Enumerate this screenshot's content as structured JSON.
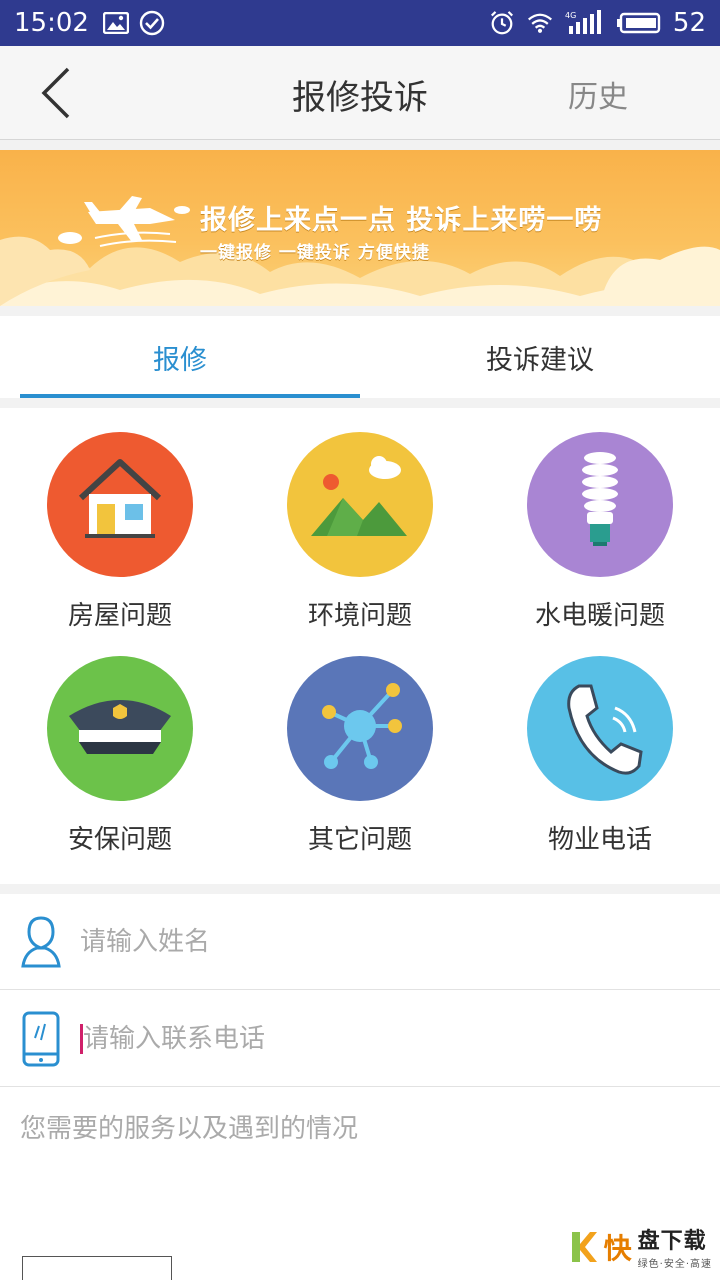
{
  "status_bar": {
    "time": "15:02",
    "battery": "52",
    "network": "4G"
  },
  "header": {
    "title": "报修投诉",
    "history": "历史"
  },
  "banner": {
    "line1": "报修上来点一点    投诉上来唠一唠",
    "line2": "一键报修   一键投诉  方便快捷"
  },
  "tabs": [
    {
      "label": "报修",
      "active": true
    },
    {
      "label": "投诉建议",
      "active": false
    }
  ],
  "categories": [
    {
      "label": "房屋问题",
      "icon": "house-icon",
      "color": "#ee5a30"
    },
    {
      "label": "环境问题",
      "icon": "landscape-icon",
      "color": "#f2c43d"
    },
    {
      "label": "水电暖问题",
      "icon": "bulb-icon",
      "color": "#a985d3"
    },
    {
      "label": "安保问题",
      "icon": "police-cap-icon",
      "color": "#6cc24a"
    },
    {
      "label": "其它问题",
      "icon": "network-icon",
      "color": "#5a76b8"
    },
    {
      "label": "物业电话",
      "icon": "phone-icon",
      "color": "#58c0e6"
    }
  ],
  "form": {
    "name_placeholder": "请输入姓名",
    "phone_placeholder": "请输入联系电话",
    "desc_placeholder": "您需要的服务以及遇到的情况"
  },
  "watermark": {
    "main": "快",
    "title": "盘下载",
    "sub": "绿色·安全·高速"
  },
  "colors": {
    "accent": "#2a8fd0",
    "status_bar": "#2f3a8f"
  }
}
